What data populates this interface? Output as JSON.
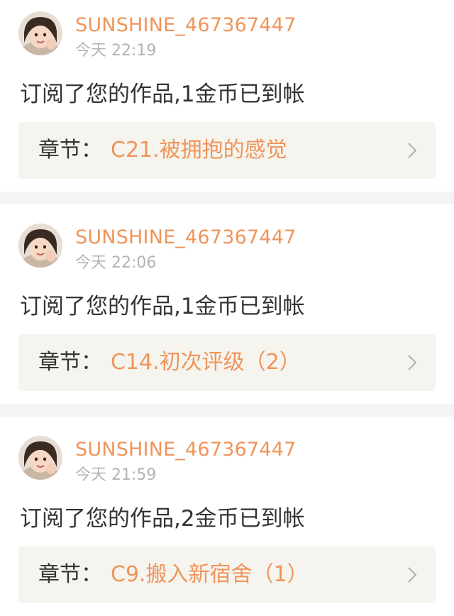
{
  "notifications": [
    {
      "username": "SUNSHINE_467367447",
      "time": "今天 22:19",
      "message": "订阅了您的作品,1金币已到帐",
      "chapter_label": "章节：",
      "chapter_title": "C21.被拥抱的感觉",
      "chevron_icon": "chevron-right-icon"
    },
    {
      "username": "SUNSHINE_467367447",
      "time": "今天 22:06",
      "message": "订阅了您的作品,1金币已到帐",
      "chapter_label": "章节：",
      "chapter_title": "C14.初次评级（2）",
      "chevron_icon": "chevron-right-icon"
    },
    {
      "username": "SUNSHINE_467367447",
      "time": "今天 21:59",
      "message": "订阅了您的作品,2金币已到帐",
      "chapter_label": "章节：",
      "chapter_title": "C9.搬入新宿舍（1）",
      "chevron_icon": "chevron-right-icon"
    }
  ],
  "colors": {
    "accent": "#f0945a",
    "text": "#333333",
    "muted": "#b3b3b3",
    "chapter_bg": "#f5f4ee",
    "separator": "#f4f4f4"
  }
}
